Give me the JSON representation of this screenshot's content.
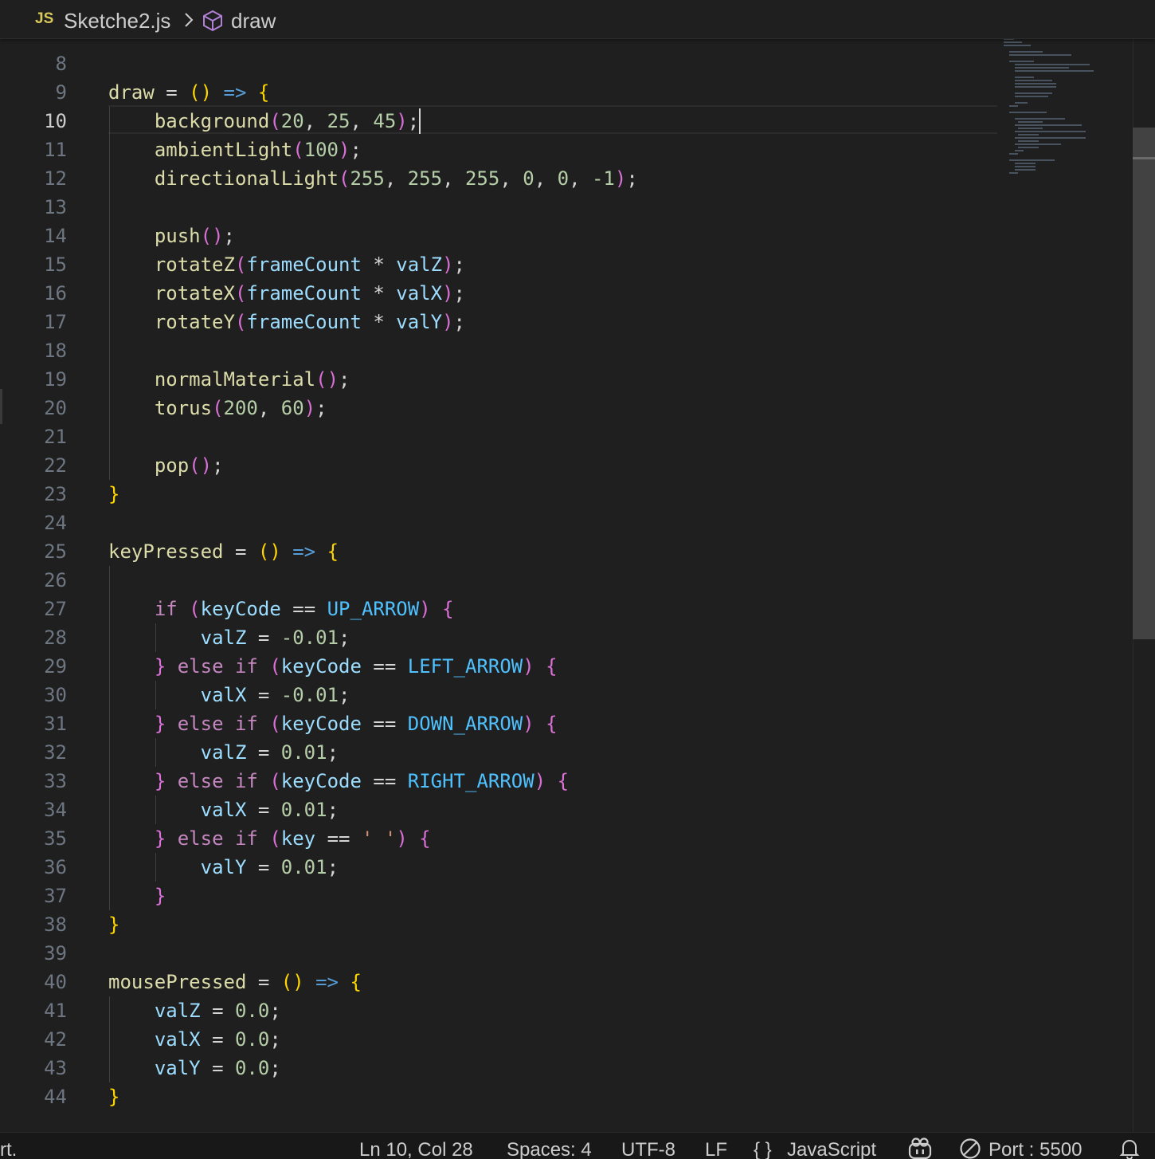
{
  "breadcrumb": {
    "file_icon": "JS",
    "file_name": "Sketche2.js",
    "separator_icon": "chevron-right-icon",
    "symbol_icon": "symbol-method-icon",
    "symbol_name": "draw"
  },
  "editor": {
    "active_line": 10,
    "lines": [
      {
        "n": "8",
        "t": ""
      },
      {
        "n": "9",
        "t": "draw = () => {"
      },
      {
        "n": "10",
        "t": "    background(20, 25, 45);"
      },
      {
        "n": "11",
        "t": "    ambientLight(100);"
      },
      {
        "n": "12",
        "t": "    directionalLight(255, 255, 255, 0, 0, -1);"
      },
      {
        "n": "13",
        "t": ""
      },
      {
        "n": "14",
        "t": "    push();"
      },
      {
        "n": "15",
        "t": "    rotateZ(frameCount * valZ);"
      },
      {
        "n": "16",
        "t": "    rotateX(frameCount * valX);"
      },
      {
        "n": "17",
        "t": "    rotateY(frameCount * valY);"
      },
      {
        "n": "18",
        "t": ""
      },
      {
        "n": "19",
        "t": "    normalMaterial();"
      },
      {
        "n": "20",
        "t": "    torus(200, 60);"
      },
      {
        "n": "21",
        "t": ""
      },
      {
        "n": "22",
        "t": "    pop();"
      },
      {
        "n": "23",
        "t": "}"
      },
      {
        "n": "24",
        "t": ""
      },
      {
        "n": "25",
        "t": "keyPressed = () => {"
      },
      {
        "n": "26",
        "t": ""
      },
      {
        "n": "27",
        "t": "    if (keyCode == UP_ARROW) {"
      },
      {
        "n": "28",
        "t": "        valZ = -0.01;"
      },
      {
        "n": "29",
        "t": "    } else if (keyCode == LEFT_ARROW) {"
      },
      {
        "n": "30",
        "t": "        valX = -0.01;"
      },
      {
        "n": "31",
        "t": "    } else if (keyCode == DOWN_ARROW) {"
      },
      {
        "n": "32",
        "t": "        valZ = 0.01;"
      },
      {
        "n": "33",
        "t": "    } else if (keyCode == RIGHT_ARROW) {"
      },
      {
        "n": "34",
        "t": "        valX = 0.01;"
      },
      {
        "n": "35",
        "t": "    } else if (key == ' ') {"
      },
      {
        "n": "36",
        "t": "        valY = 0.01;"
      },
      {
        "n": "37",
        "t": "    }"
      },
      {
        "n": "38",
        "t": "}"
      },
      {
        "n": "39",
        "t": ""
      },
      {
        "n": "40",
        "t": "mousePressed = () => {"
      },
      {
        "n": "41",
        "t": "    valZ = 0.0;"
      },
      {
        "n": "42",
        "t": "    valX = 0.0;"
      },
      {
        "n": "43",
        "t": "    valY = 0.0;"
      },
      {
        "n": "44",
        "t": "}"
      }
    ]
  },
  "statusbar": {
    "left_text": "rt.",
    "position": "Ln 10, Col 28",
    "indent": "Spaces: 4",
    "encoding": "UTF-8",
    "eol": "LF",
    "language_icon": "{ }",
    "language": "JavaScript",
    "copilot_icon": "copilot-icon",
    "port_icon": "no-entry-icon",
    "port": "Port : 5500",
    "notifications_icon": "bell-icon"
  },
  "colors": {
    "background": "#1f1f1f",
    "function": "#dcdcaa",
    "number": "#b5cea8",
    "keyword": "#c586c0",
    "variable": "#9cdcfe",
    "constant": "#4fc1ff",
    "bracket_level1": "#ffd700",
    "bracket_level2": "#da70d6",
    "bracket_level3": "#179fff"
  }
}
